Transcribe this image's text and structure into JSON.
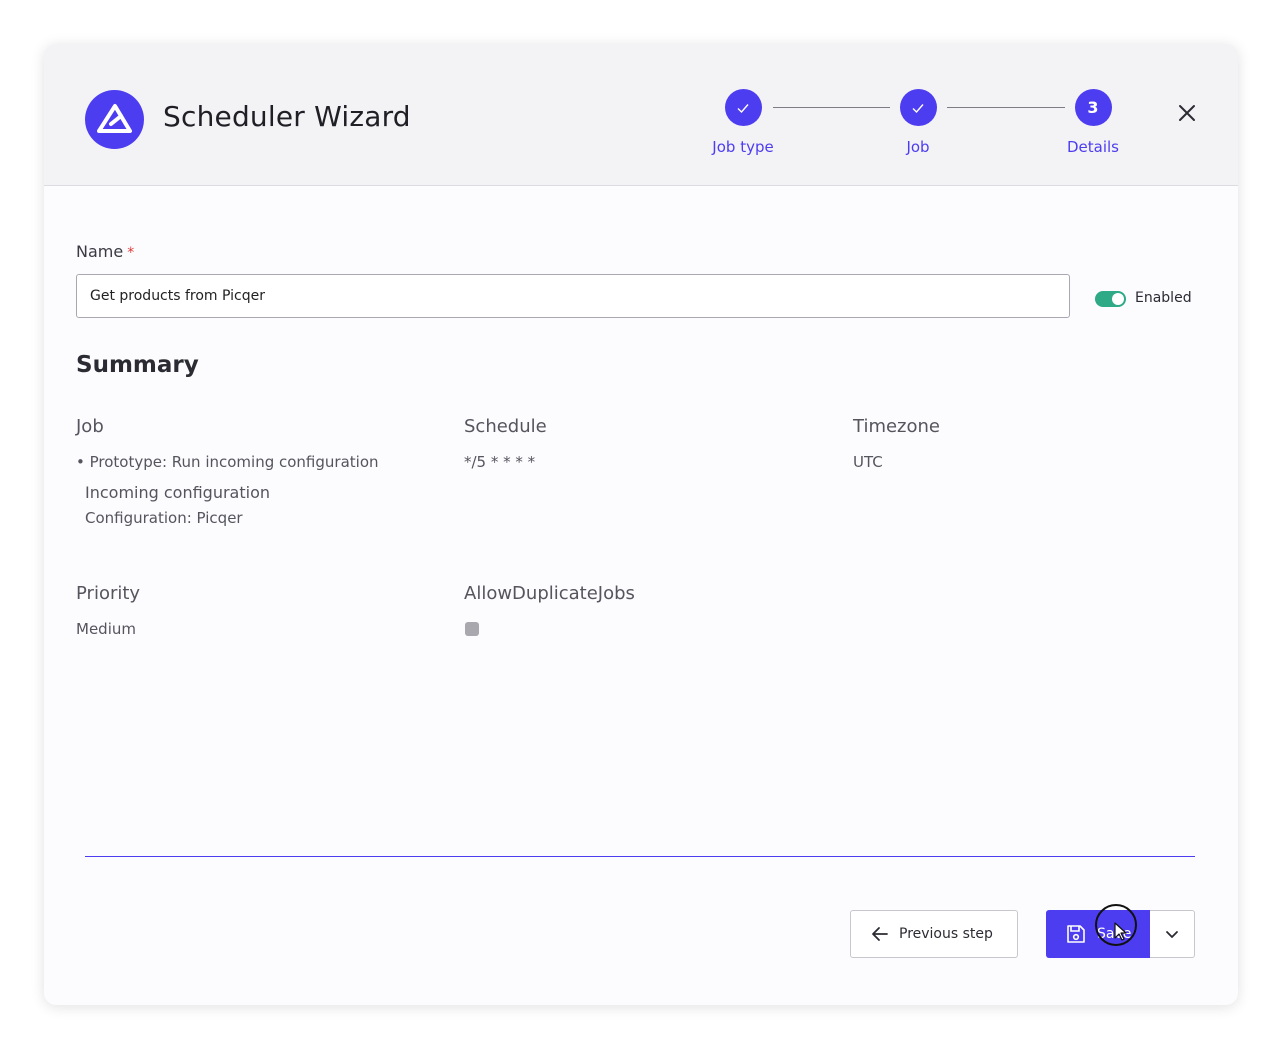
{
  "header": {
    "title": "Scheduler Wizard",
    "steps": [
      {
        "label": "Job type",
        "state": "done"
      },
      {
        "label": "Job",
        "state": "done"
      },
      {
        "label": "Details",
        "number": "3",
        "state": "current"
      }
    ]
  },
  "form": {
    "name_label": "Name",
    "required_mark": "*",
    "name_value": "Get products from Picqer",
    "enabled_label": "Enabled",
    "enabled": true
  },
  "summary": {
    "title": "Summary",
    "job": {
      "heading": "Job",
      "item": "• Prototype: Run incoming configuration",
      "sub_heading": "Incoming configuration",
      "sub_value": "Configuration: Picqer"
    },
    "schedule": {
      "heading": "Schedule",
      "value": "*/5 * * * *"
    },
    "timezone": {
      "heading": "Timezone",
      "value": "UTC"
    },
    "priority": {
      "heading": "Priority",
      "value": "Medium"
    },
    "allow_duplicate_jobs": {
      "heading": "AllowDuplicateJobs",
      "checked": false
    }
  },
  "footer": {
    "prev_label": "Previous step",
    "save_label": "Save"
  },
  "colors": {
    "accent": "#4d3df0",
    "toggle_on": "#2eaa86"
  }
}
